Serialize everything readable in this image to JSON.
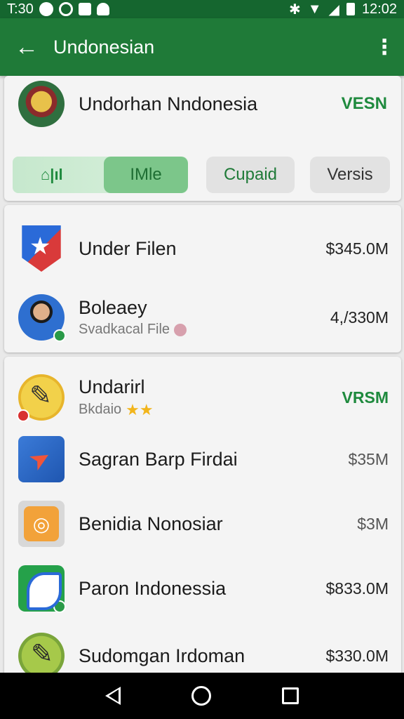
{
  "status_bar": {
    "left_text": "T:30",
    "time": "12:02",
    "left_icons": [
      "notification-dot-icon",
      "sync-icon",
      "app-icon",
      "cat-icon"
    ],
    "right_icons": [
      "bluetooth-icon",
      "wifi-icon",
      "signal-icon",
      "battery-icon"
    ]
  },
  "app_bar": {
    "title": "Undonesian",
    "back_icon": "arrow-left-icon",
    "menu_icon": "more-vertical-icon"
  },
  "header_card": {
    "name": "Undorhan Nndonesia",
    "tag": "VESN",
    "tabs": [
      {
        "label": "",
        "icon": "home-icon",
        "selected": false
      },
      {
        "label": "IMle",
        "selected": true
      },
      {
        "label": "Cupaid",
        "selected": false
      },
      {
        "label": "Versis",
        "selected": false
      }
    ],
    "home_glyph": "⌂|ıl"
  },
  "group1": [
    {
      "name": "Under Filen",
      "subtitle": "",
      "value": "$345.0M",
      "icon": "flag-star-icon"
    },
    {
      "name": "Boleaey",
      "subtitle": "Svadkacal File",
      "value": "4,/330M",
      "icon": "person-avatar-icon"
    }
  ],
  "group2": [
    {
      "name": "Undarirl",
      "subtitle": "Bkdaio",
      "value": "VRSM",
      "icon": "pen-icon",
      "rating": "★★"
    },
    {
      "name": "Sagran Barp Firdai",
      "subtitle": "",
      "value": "$35M",
      "icon": "paper-plane-icon"
    },
    {
      "name": "Benidia Nonosiar",
      "subtitle": "",
      "value": "$3M",
      "icon": "timer-icon"
    },
    {
      "name": "Paron Indonessia",
      "subtitle": "",
      "value": "$833.0M",
      "icon": "leaf-icon"
    },
    {
      "name": "Sudomgan Irdoman",
      "subtitle": "",
      "value": "$330.0M",
      "icon": "pencil-icon"
    }
  ],
  "colors": {
    "primary": "#1f7a38",
    "status_bar": "#15662f",
    "accent_green": "#1f8a3e"
  }
}
